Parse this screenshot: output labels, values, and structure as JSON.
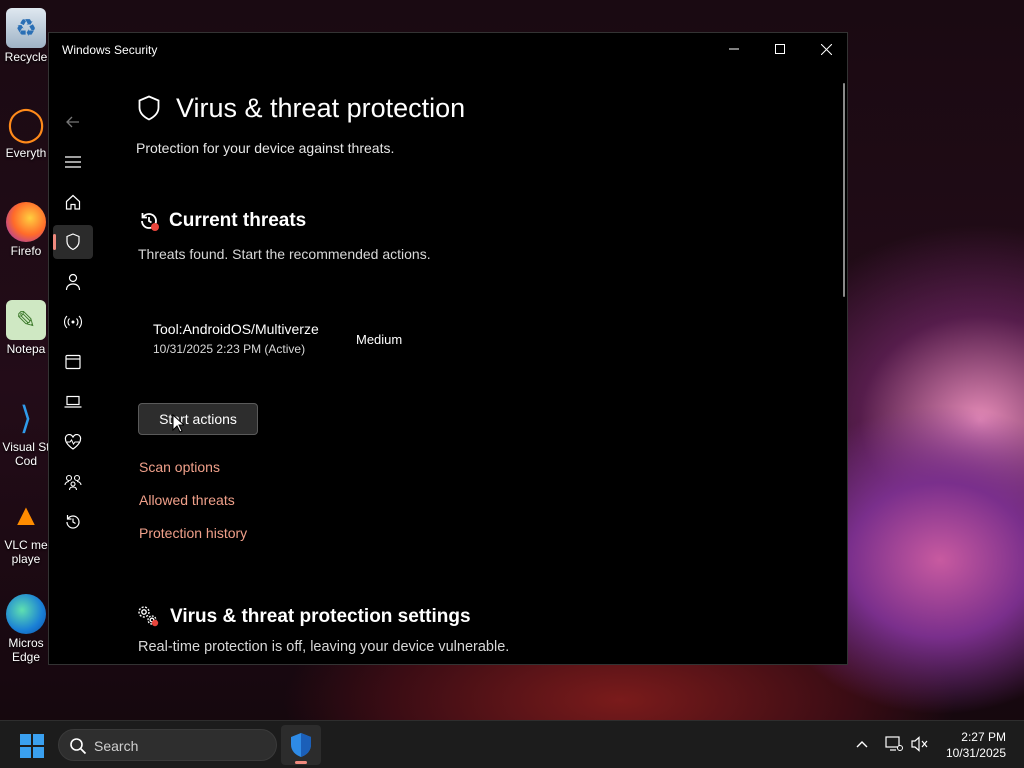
{
  "desktop": {
    "icons": [
      {
        "label": "Recycle"
      },
      {
        "label": "Everyth"
      },
      {
        "label": "Firefo"
      },
      {
        "label": "Notepa"
      },
      {
        "label": "Visual St\nCod"
      },
      {
        "label": "VLC me\nplaye"
      },
      {
        "label": "Micros\nEdge"
      }
    ]
  },
  "window": {
    "title": "Windows Security",
    "page": {
      "title": "Virus & threat protection",
      "subtitle": "Protection for your device against threats."
    },
    "current_threats": {
      "title": "Current threats",
      "description": "Threats found. Start the recommended actions.",
      "threat": {
        "name": "Tool:AndroidOS/Multiverze",
        "date": "10/31/2025 2:23 PM (Active)",
        "severity": "Medium"
      },
      "start_button": "Start actions",
      "links": [
        "Scan options",
        "Allowed threats",
        "Protection history"
      ]
    },
    "settings": {
      "title": "Virus & threat protection settings",
      "description": "Real-time protection is off, leaving your device vulnerable."
    }
  },
  "taskbar": {
    "search_placeholder": "Search",
    "clock": {
      "time": "2:27 PM",
      "date": "10/31/2025"
    }
  },
  "colors": {
    "accent": "#f08a7e",
    "link": "#f0a08a"
  }
}
